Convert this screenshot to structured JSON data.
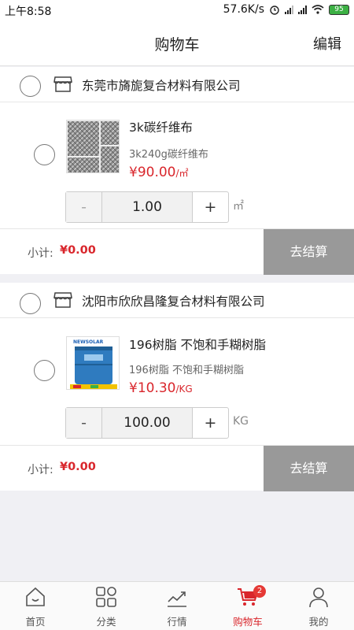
{
  "status_bar": {
    "time": "上午8:58",
    "speed": "57.6K/s",
    "battery": "95"
  },
  "header": {
    "title": "购物车",
    "edit_label": "编辑"
  },
  "shops": [
    {
      "name": "东莞市旖旎复合材料有限公司",
      "product": {
        "title": "3k碳纤维布",
        "subtitle": "3k240g碳纤维布",
        "price": "¥90.00",
        "price_unit": "/㎡",
        "quantity": "1.00",
        "quantity_unit": "㎡",
        "minus_label": "-",
        "plus_label": "+"
      },
      "subtotal_label": "小计:",
      "subtotal_value": "¥0.00",
      "checkout_label": "去结算"
    },
    {
      "name": "沈阳市欣欣昌隆复合材料有限公司",
      "product": {
        "title": "196树脂 不饱和手糊树脂",
        "subtitle": "196树脂 不饱和手糊树脂",
        "price": "¥10.30",
        "price_unit": "/KG",
        "quantity": "100.00",
        "quantity_unit": "KG",
        "minus_label": "-",
        "plus_label": "+",
        "image_brand": "NEWSOLAR"
      },
      "subtotal_label": "小计:",
      "subtotal_value": "¥0.00",
      "checkout_label": "去结算"
    }
  ],
  "tabbar": [
    {
      "label": "首页",
      "icon": "home-icon"
    },
    {
      "label": "分类",
      "icon": "category-icon"
    },
    {
      "label": "行情",
      "icon": "market-trend-icon"
    },
    {
      "label": "购物车",
      "icon": "cart-icon",
      "badge": "2",
      "active": true
    },
    {
      "label": "我的",
      "icon": "profile-icon"
    }
  ],
  "colors": {
    "accent": "#d9262c",
    "checkout_bg": "#999999"
  }
}
